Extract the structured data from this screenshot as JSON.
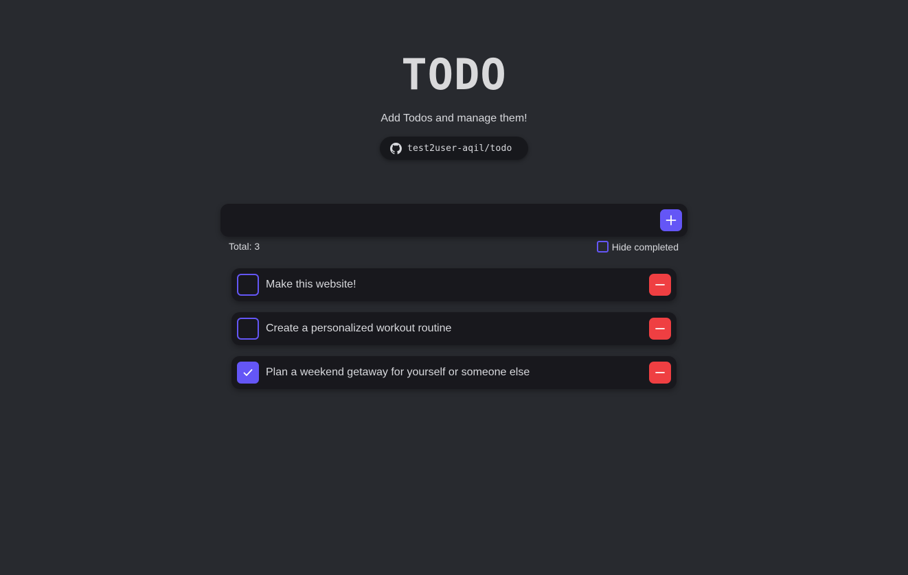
{
  "header": {
    "title": "TODO",
    "subtitle": "Add Todos and manage them!",
    "repo_link": {
      "icon": "github-icon",
      "label": "test2user-aqil/todo"
    }
  },
  "add_bar": {
    "input_value": "",
    "placeholder": "",
    "add_button_icon": "plus-icon"
  },
  "meta": {
    "total_label": "Total: 3",
    "hide_completed_label": "Hide completed",
    "hide_completed_checked": false
  },
  "todos": [
    {
      "label": "Make this website!",
      "completed": false,
      "delete_icon": "minus-icon"
    },
    {
      "label": "Create a personalized workout routine",
      "completed": false,
      "delete_icon": "minus-icon"
    },
    {
      "label": "Plan a weekend getaway for yourself or someone else",
      "completed": true,
      "delete_icon": "minus-icon"
    }
  ],
  "colors": {
    "background": "#282a2f",
    "card": "#18181d",
    "accent": "#6456f6",
    "danger": "#ef3f42",
    "text": "#d7d8dc"
  }
}
